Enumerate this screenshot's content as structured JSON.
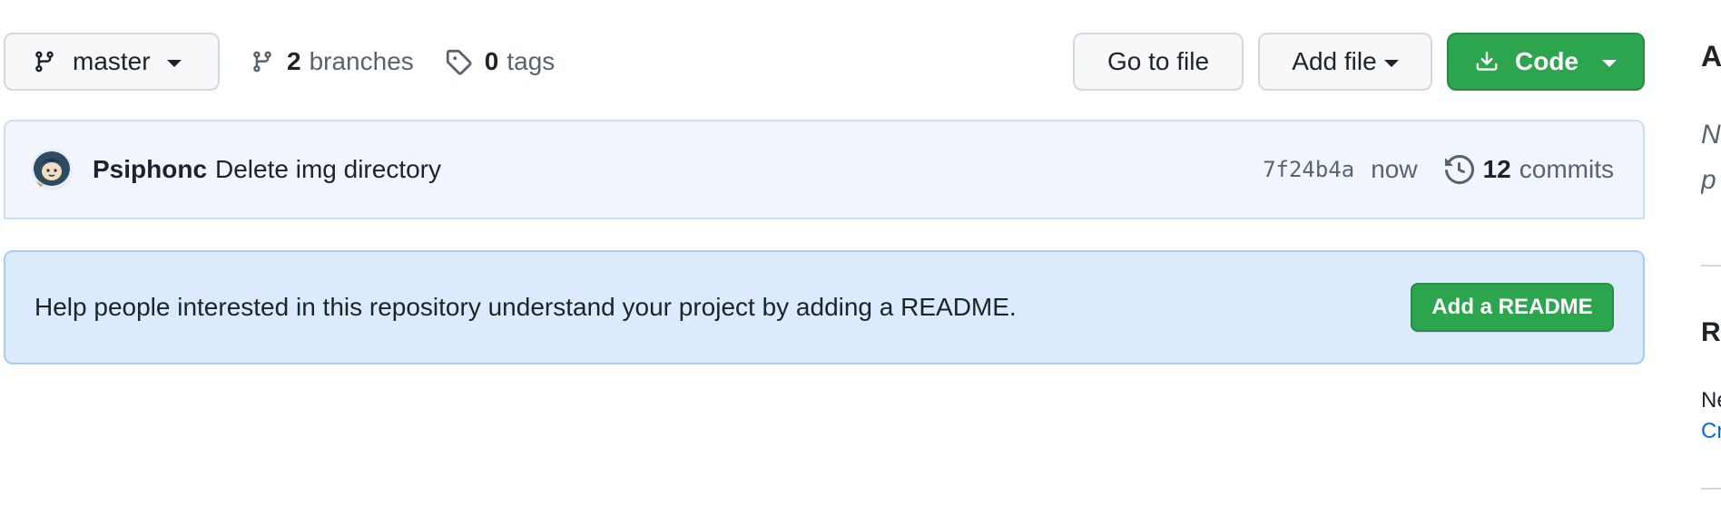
{
  "toolbar": {
    "branch_name": "master",
    "branches_count": "2",
    "branches_label": "branches",
    "tags_count": "0",
    "tags_label": "tags",
    "goto_file_label": "Go to file",
    "add_file_label": "Add file",
    "code_label": "Code"
  },
  "commit": {
    "author": "Psiphonc",
    "message": "Delete img directory",
    "sha": "7f24b4a",
    "time": "now",
    "commit_count": "12",
    "commit_label": "commits"
  },
  "readme": {
    "prompt_text": "Help people interested in this repository understand your project by adding a README.",
    "button_label": "Add a README"
  },
  "sidebar": {
    "about_title": "A",
    "description_line1": "N",
    "description_line2": "p",
    "releases_title": "R",
    "no_releases_text": "Ne",
    "create_link": "Cr"
  },
  "colors": {
    "primary_green": "#2da44e",
    "commit_bar_bg": "#f0f6fc",
    "readme_banner_bg": "#dbeafc",
    "link_blue": "#0969da",
    "muted_text": "#59636e"
  },
  "icons": {
    "branch": "git-branch-icon",
    "tag": "tag-icon",
    "download": "download-icon",
    "history": "history-icon"
  }
}
